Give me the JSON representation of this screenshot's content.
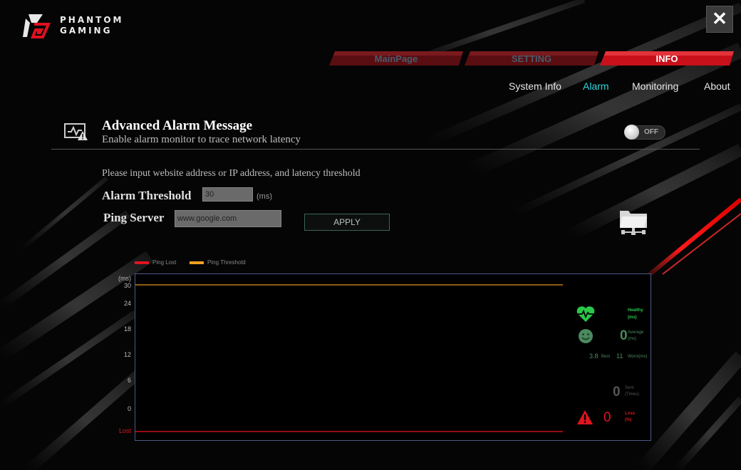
{
  "brand": {
    "line1": "PHANTOM",
    "line2": "GAMING"
  },
  "window": {
    "close_label": "✕"
  },
  "main_tabs": [
    {
      "label": "MainPage"
    },
    {
      "label": "SETTING"
    },
    {
      "label": "INFO"
    }
  ],
  "sub_nav": [
    {
      "label": "System Info"
    },
    {
      "label": "Alarm"
    },
    {
      "label": "Monitoring"
    },
    {
      "label": "About"
    }
  ],
  "alarm": {
    "title": "Advanced Alarm Message",
    "subtitle": "Enable alarm monitor to trace network latency",
    "toggle_label": "OFF",
    "instructions": "Please input website address or IP address, and latency threshold",
    "threshold_label": "Alarm Threshold",
    "threshold_value": "30",
    "threshold_unit": "(ms)",
    "ping_label": "Ping Server",
    "ping_value": "www.google.com",
    "apply_label": "APPLY"
  },
  "chart_data": {
    "type": "line",
    "legend": [
      "Ping Lost",
      "Ping Threshold"
    ],
    "ylabel": "(ms)",
    "y_ticks": [
      "30",
      "24",
      "18",
      "12",
      "6",
      "0",
      "Lost"
    ],
    "series": [
      {
        "name": "Ping Threshold",
        "values": [
          30,
          30
        ],
        "color": "#c07a1a"
      },
      {
        "name": "Ping Lost",
        "values": [
          "Lost",
          "Lost"
        ],
        "color": "#c8101a"
      }
    ],
    "legend_colors": [
      "#e0141e",
      "#f0a020"
    ]
  },
  "stats": {
    "healthy_label": "Healthy",
    "healthy_unit": "(ms)",
    "average_value": "0",
    "average_label": "Average",
    "average_unit": "(ms)",
    "best_value": "3.8",
    "best_label": "Best",
    "worst_value": "11",
    "worst_label": "Worst(ms)",
    "sent_value": "0",
    "sent_label": "Sent",
    "sent_unit": "(Times)",
    "loss_value": "0",
    "loss_label": "Loss",
    "loss_unit": "(%)"
  },
  "colors": {
    "accent_red": "#c8101a",
    "active_nav": "#2fd7df",
    "healthy_green": "#29c84a"
  }
}
